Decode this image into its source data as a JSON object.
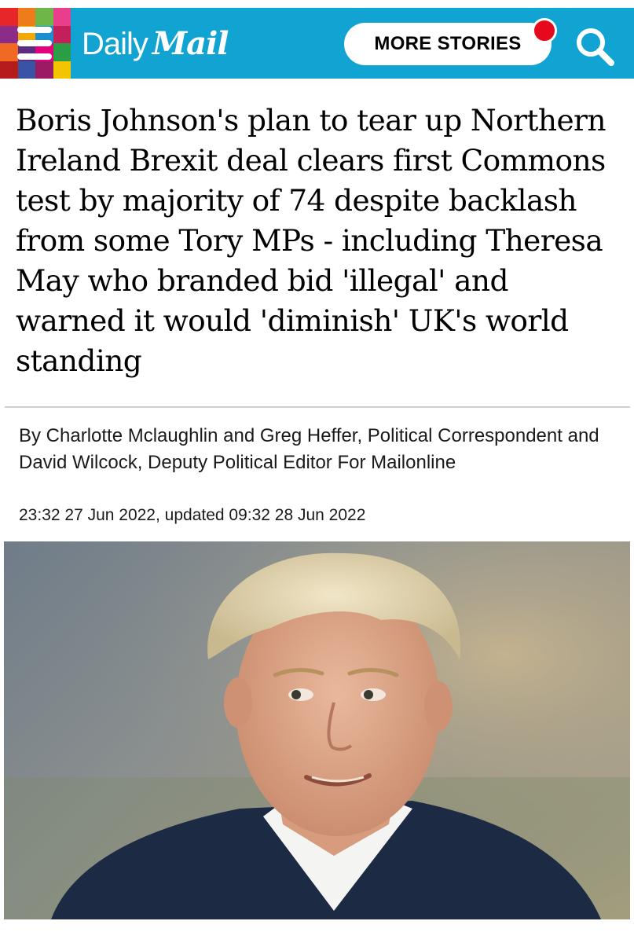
{
  "header": {
    "logo_daily": "Daily",
    "logo_mail": "Mail",
    "more_stories_label": "MORE STORIES",
    "background_color": "#11a3d2",
    "menu_icon": "hamburger-menu-icon",
    "search_icon": "search-icon",
    "notification_color": "#e6081c",
    "menu_tile_colors": [
      "#e7262a",
      "#ef7c1a",
      "#6fb648",
      "#e83e8c",
      "#8b2c88",
      "#f2a900",
      "#1b8fd0",
      "#c21f5b",
      "#f06a24",
      "#5a2d82",
      "#e4007c",
      "#2a9d46",
      "#b71c1c",
      "#3a53a4",
      "#9a1b63",
      "#f2c500"
    ]
  },
  "article": {
    "headline": "Boris Johnson's plan to tear up Northern Ireland Brexit deal clears first Commons test by majority of 74 despite backlash from some Tory MPs - including Theresa May who branded bid 'illegal' and warned it would 'diminish' UK's world standing",
    "byline": "By Charlotte Mclaughlin and Greg Heffer, Political Correspondent and David Wilcock, Deputy Political Editor For Mailonline",
    "timestamp": "23:32 27 Jun 2022, updated 09:32 28 Jun 2022"
  }
}
